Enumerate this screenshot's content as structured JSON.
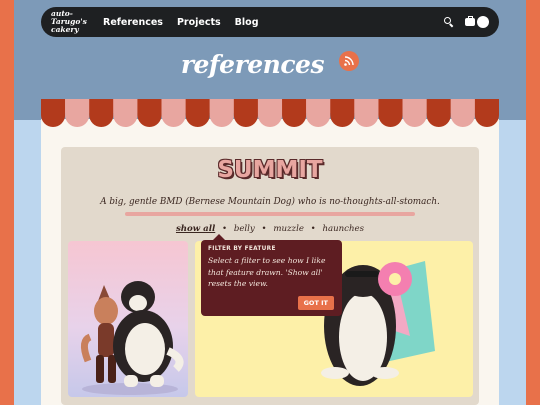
{
  "brand": {
    "logo_line1": "auto-Tarugo's",
    "logo_line2": "cakery"
  },
  "nav": {
    "links": [
      "References",
      "Projects",
      "Blog"
    ]
  },
  "icons": {
    "search": "search-icon",
    "shop": "bag-icon",
    "theme": "toggle-icon",
    "rss": "rss-icon"
  },
  "page": {
    "title": "references"
  },
  "reference": {
    "name": "SUMMIT",
    "description": "A big, gentle BMD (Bernese Mountain Dog) who is no-thoughts-all-stomach."
  },
  "filters": {
    "items": [
      "show all",
      "belly",
      "muzzle",
      "haunches"
    ],
    "active_index": 0
  },
  "tooltip": {
    "heading": "FILTER BY FEATURE",
    "body": "Select a filter to see how I like that feature drawn. 'Show all' resets the view.",
    "button": "GOT IT"
  },
  "colors": {
    "accent": "#e8714a",
    "nav_bg": "#1e2022",
    "tooltip_bg": "#5e1d22",
    "sky": "#7d9ab8"
  }
}
